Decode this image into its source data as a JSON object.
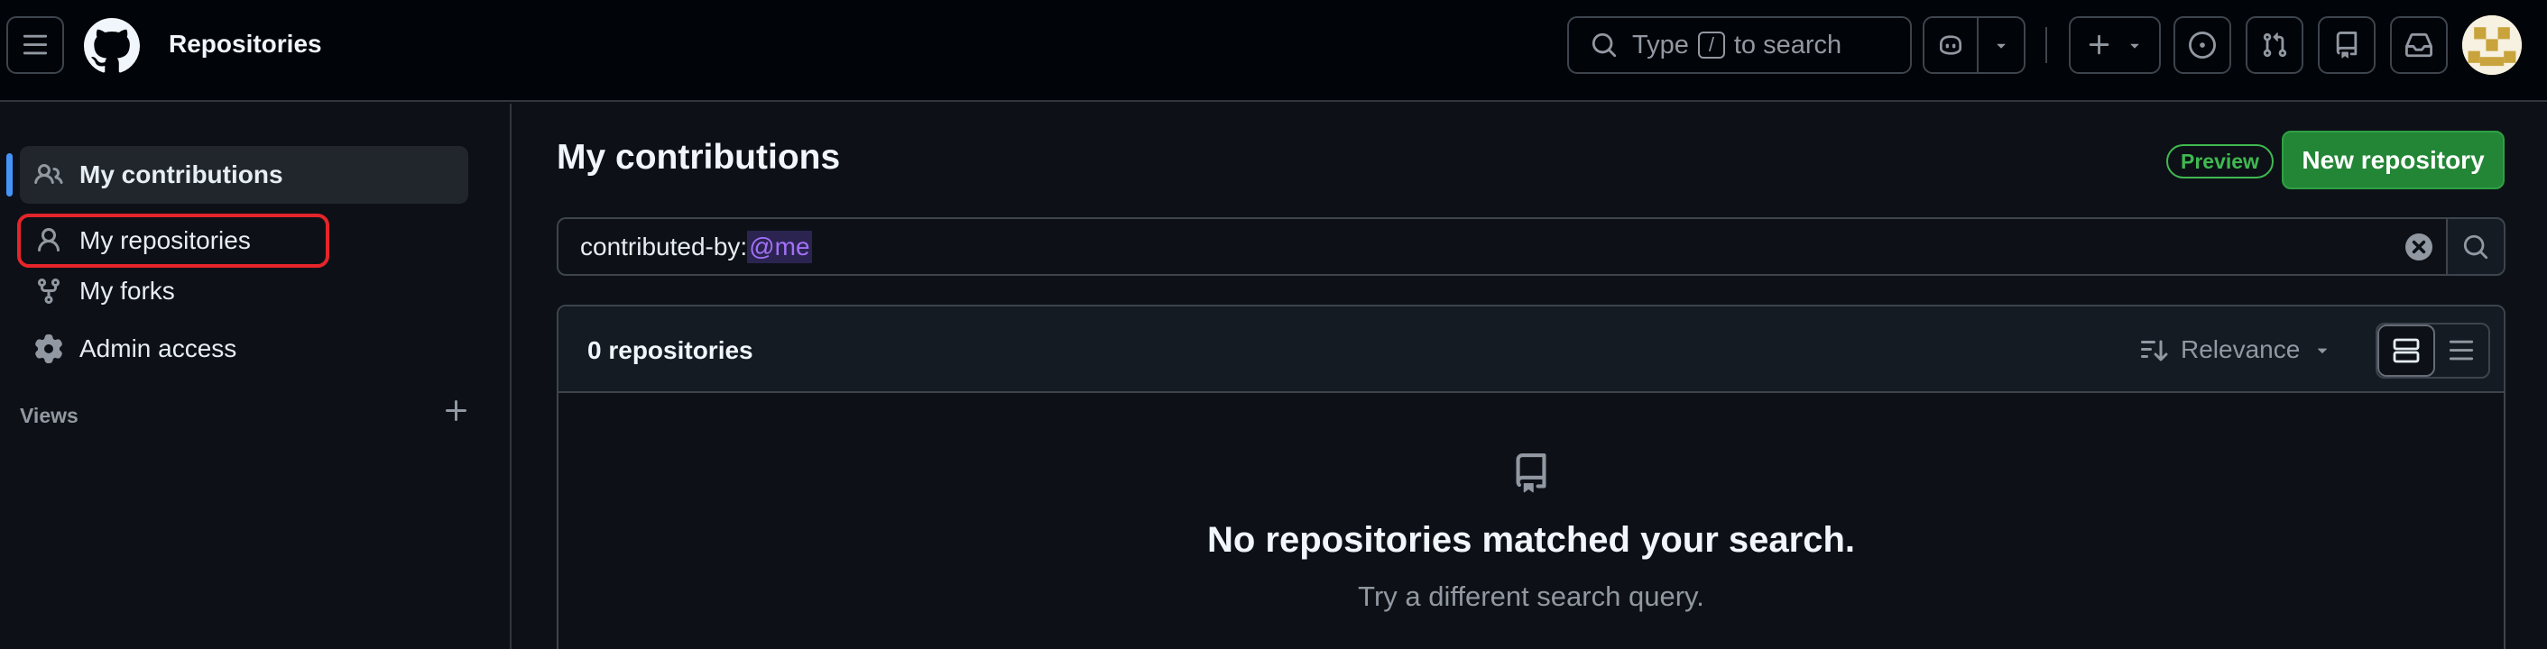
{
  "header": {
    "title": "Repositories",
    "search": {
      "prefix": "Type",
      "key": "/",
      "suffix": "to search"
    },
    "icons": [
      "hamburger-icon",
      "github-logo",
      "search-icon",
      "copilot-icon",
      "chevron-down-icon",
      "plus-icon",
      "issue-icon",
      "pull-request-icon",
      "repo-icon",
      "inbox-icon"
    ]
  },
  "sidebar": {
    "items": [
      {
        "label": "My contributions",
        "icon": "people-icon",
        "active": true
      },
      {
        "label": "My repositories",
        "icon": "person-icon",
        "active": false
      },
      {
        "label": "My forks",
        "icon": "fork-icon",
        "active": false
      },
      {
        "label": "Admin access",
        "icon": "gear-icon",
        "active": false
      }
    ],
    "views_label": "Views"
  },
  "main": {
    "title": "My contributions",
    "preview_badge": "Preview",
    "new_repo_label": "New repository",
    "filter": {
      "qualifier": "contributed-by:",
      "value": "@me"
    },
    "results": {
      "count_label": "0 repositories",
      "sort_label": "Relevance",
      "empty_title": "No repositories matched your search.",
      "empty_subtitle": "Try a different search query."
    }
  },
  "colors": {
    "background": "#0d1117",
    "header_bg": "#010409",
    "primary_button": "#238636",
    "accent_bar": "#4493f8",
    "highlight_box": "#e5252a",
    "preview_badge": "#3fb950",
    "token": "#a371f7"
  }
}
